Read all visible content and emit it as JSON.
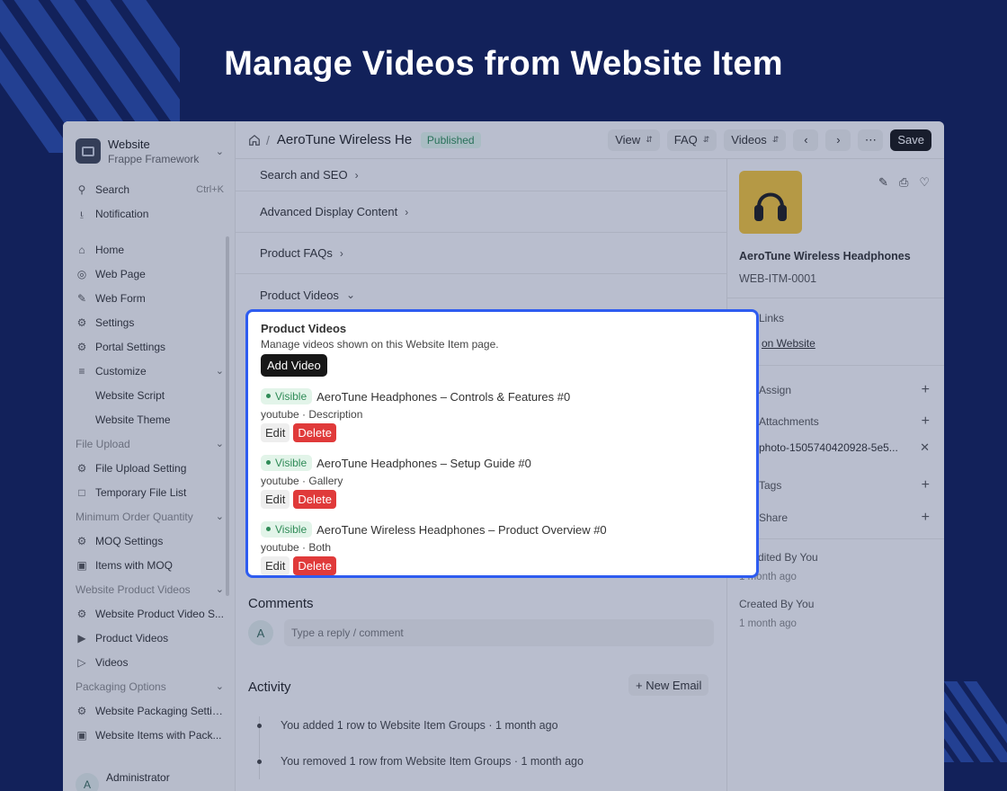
{
  "headline": "Manage Videos from Website Item",
  "colors": {
    "background": "#12215a",
    "accent": "#2e5cf0",
    "danger": "#e03a3a",
    "success": "#2f8b57"
  },
  "sidebar": {
    "workspace_name": "Website",
    "workspace_sub": "Frappe Framework",
    "search_label": "Search",
    "search_shortcut": "Ctrl+K",
    "notification_label": "Notification",
    "items": [
      {
        "label": "Home",
        "icon": "home-icon"
      },
      {
        "label": "Web Page",
        "icon": "globe-icon"
      },
      {
        "label": "Web Form",
        "icon": "form-icon"
      },
      {
        "label": "Settings",
        "icon": "gear-icon"
      },
      {
        "label": "Portal Settings",
        "icon": "gear-icon"
      },
      {
        "label": "Customize",
        "icon": "sliders-icon"
      },
      {
        "label": "Website Script"
      },
      {
        "label": "Website Theme"
      },
      {
        "label": "File Upload"
      },
      {
        "label": "File Upload Setting",
        "icon": "gear-icon"
      },
      {
        "label": "Temporary File List",
        "icon": "file-icon"
      },
      {
        "label": "Minimum Order Quantity"
      },
      {
        "label": "MOQ Settings",
        "icon": "gear-icon"
      },
      {
        "label": "Items with MOQ",
        "icon": "package-icon"
      },
      {
        "label": "Website Product Videos"
      },
      {
        "label": "Website Product Video S...",
        "icon": "gear-icon"
      },
      {
        "label": "Product Videos",
        "icon": "video-icon"
      },
      {
        "label": "Videos",
        "icon": "play-icon"
      },
      {
        "label": "Packaging Options"
      },
      {
        "label": "Website Packaging Settin...",
        "icon": "gear-icon"
      },
      {
        "label": "Website Items with Pack...",
        "icon": "package-icon"
      }
    ],
    "user_name": "Administrator",
    "user_initial": "A"
  },
  "topbar": {
    "doc_title": "AeroTune Wireless He",
    "status": "Published",
    "view_label": "View",
    "faq_label": "FAQ",
    "videos_label": "Videos",
    "save_label": "Save"
  },
  "sections": [
    "Search and SEO",
    "Advanced Display Content",
    "Product FAQs",
    "Product Videos"
  ],
  "modal": {
    "title": "Product Videos",
    "subtitle": "Manage videos shown on this Website Item page.",
    "add_label": "Add Video",
    "edit_label": "Edit",
    "delete_label": "Delete",
    "videos": [
      {
        "status": "Visible",
        "title": "AeroTune Headphones – Controls & Features #0",
        "meta": "youtube · Description"
      },
      {
        "status": "Visible",
        "title": "AeroTune Headphones – Setup Guide #0",
        "meta": "youtube · Gallery"
      },
      {
        "status": "Visible",
        "title": "AeroTune Wireless Headphones – Product Overview #0",
        "meta": "youtube · Both"
      }
    ]
  },
  "comments": {
    "heading": "Comments",
    "avatar_initial": "A",
    "placeholder": "Type a reply / comment"
  },
  "activity": {
    "heading": "Activity",
    "new_email_label": "+ New Email",
    "items": [
      "You added 1 row to Website Item Groups · 1 month ago",
      "You removed 1 row from Website Item Groups · 1 month ago"
    ]
  },
  "right_panel": {
    "item_name": "AeroTune Wireless Headphones",
    "item_code": "WEB-ITM-0001",
    "links_label": "Links",
    "website_link": "on Website",
    "assign_label": "Assign",
    "attachments_label": "Attachments",
    "attachment_file": "photo-1505740420928-5e5...",
    "tags_label": "Tags",
    "share_label": "Share",
    "edited_by": "Edited By You",
    "edited_time": "1 month ago",
    "created_by": "Created By You",
    "created_time": "1 month ago"
  }
}
